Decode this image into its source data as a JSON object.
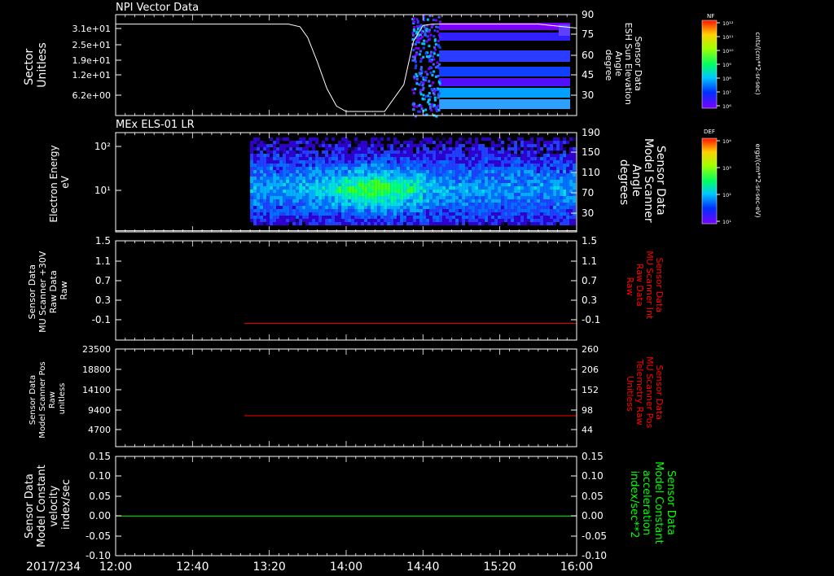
{
  "date_label": "2017/234",
  "x_axis": {
    "ticks": [
      "12:00",
      "12:40",
      "13:20",
      "14:00",
      "14:40",
      "15:20",
      "16:00"
    ]
  },
  "panels": [
    {
      "id": "npi",
      "title": "NPI Vector Data",
      "left_label": [
        "Sector",
        "Unitless"
      ],
      "right_label": [
        "Sensor Data",
        "ESH Sun Elevation",
        "Angle",
        "degree"
      ],
      "left_ticks": [
        "3.1e+01",
        "2.5e+01",
        "1.9e+01",
        "1.2e+01",
        "6.2e+00"
      ],
      "right_ticks": [
        "90",
        "75",
        "60",
        "45",
        "30"
      ]
    },
    {
      "id": "els",
      "title": "MEx ELS-01 LR",
      "left_label": [
        "Electron Energy",
        "eV"
      ],
      "right_label": [
        "Sensor Data",
        "Model Scanner",
        "Angle",
        "degrees"
      ],
      "left_ticks": [
        "10²",
        "10¹"
      ],
      "right_ticks": [
        "190",
        "150",
        "110",
        "70",
        "30"
      ]
    },
    {
      "id": "mu_int",
      "title": "",
      "left_label": [
        "Sensor Data",
        "MU Scanner +30V",
        "Raw Data",
        "Raw"
      ],
      "right_label": [
        "Sensor Data",
        "MU Scanner Int",
        "Raw Data",
        "Raw"
      ],
      "left_ticks": [
        "1.5",
        "1.1",
        "0.7",
        "0.3",
        "-0.1"
      ],
      "right_ticks": [
        "1.5",
        "1.1",
        "0.7",
        "0.3",
        "-0.1"
      ]
    },
    {
      "id": "mu_pos",
      "title": "",
      "left_label": [
        "Sensor Data",
        "Model Scanner Pos",
        "Raw",
        "unitless"
      ],
      "right_label": [
        "Sensor Data",
        "MU Scanner Pos",
        "Telemetry Raw",
        "Unitless"
      ],
      "left_ticks": [
        "23500",
        "18800",
        "14100",
        "9400",
        "4700"
      ],
      "right_ticks": [
        "260",
        "206",
        "152",
        "98",
        "44"
      ]
    },
    {
      "id": "model_const",
      "title": "",
      "left_label": [
        "Sensor Data",
        "Model Constant",
        "velocity",
        "index/sec"
      ],
      "right_label": [
        "Sensor Data",
        "Model Constant",
        "acceleration",
        "index/sec**2"
      ],
      "left_ticks": [
        "0.15",
        "0.10",
        "0.05",
        "0.00",
        "-0.05",
        "-0.10"
      ],
      "right_ticks": [
        "0.15",
        "0.10",
        "0.05",
        "0.00",
        "-0.05",
        "-0.10"
      ]
    }
  ],
  "colorbars": [
    {
      "id": "nf",
      "label": "NF",
      "units": "cnts/(cm**2-sr-sec)",
      "ticks": [
        "10¹²",
        "10¹¹",
        "10¹⁰",
        "10⁹",
        "10⁸",
        "10⁷",
        "10⁶"
      ]
    },
    {
      "id": "def",
      "label": "DEF",
      "units": "ergs/(cm**2-sr-sec-eV)",
      "ticks": [
        "10⁴",
        "10³",
        "10²",
        "10¹"
      ]
    }
  ],
  "chart_data": [
    {
      "type": "heatmap",
      "title": "NPI Vector Data",
      "x_range": [
        "12:00",
        "16:00"
      ],
      "y_label": "Sector Unitless",
      "ylim": [
        0,
        31
      ],
      "data_start": "14:34",
      "overlay_line": {
        "name": "Sensor Data ESH Sun Elevation Angle",
        "units": "degree",
        "ylim": [
          15,
          90
        ],
        "x": [
          "12:00",
          "13:30",
          "13:36",
          "13:40",
          "13:45",
          "13:50",
          "13:55",
          "14:00",
          "14:05",
          "14:10",
          "14:20",
          "14:30",
          "14:35",
          "14:40",
          "14:45",
          "15:20",
          "15:40",
          "16:00"
        ],
        "y": [
          83,
          83,
          81,
          73,
          55,
          35,
          22,
          18,
          18,
          18,
          18,
          38,
          70,
          82,
          83,
          83,
          83,
          80
        ]
      }
    },
    {
      "type": "heatmap",
      "title": "MEx ELS-01 LR",
      "x_range": [
        "12:00",
        "16:00"
      ],
      "y_label": "Electron Energy eV",
      "y_scale": "log",
      "data_start": "13:10",
      "peak_interval": [
        "13:50",
        "14:40"
      ],
      "overlay_line": {
        "name": "Sensor Data Model Scanner Angle",
        "units": "degrees",
        "ylim": [
          10,
          190
        ],
        "x": [
          "12:00",
          "16:00"
        ],
        "y": [
          12,
          12
        ]
      }
    },
    {
      "type": "line",
      "x_range": [
        "12:00",
        "16:00"
      ],
      "series": [
        {
          "name": "Sensor Data MU Scanner Int Raw Data Raw",
          "color": "#ff0000",
          "x": [
            "13:07",
            "16:00"
          ],
          "y": [
            0,
            0
          ]
        }
      ],
      "ylim": [
        -0.3,
        1.5
      ]
    },
    {
      "type": "line",
      "x_range": [
        "12:00",
        "16:00"
      ],
      "series": [
        {
          "name": "Sensor Data MU Scanner Pos Telemetry Raw Unitless",
          "color": "#ff0000",
          "x": [
            "13:07",
            "16:00"
          ],
          "y": [
            94,
            94
          ]
        }
      ],
      "ylim": [
        17,
        260
      ]
    },
    {
      "type": "line",
      "x_range": [
        "12:00",
        "16:00"
      ],
      "series": [
        {
          "name": "Sensor Data Model Constant velocity index/sec",
          "color": "#00ff00",
          "x": [
            "12:00",
            "16:00"
          ],
          "y": [
            0,
            0
          ]
        }
      ],
      "ylim": [
        -0.1,
        0.15
      ]
    }
  ],
  "colors": {
    "line_red": "#ff0000",
    "line_green": "#00ff00",
    "axis": "#ffffff",
    "background": "#000000"
  }
}
